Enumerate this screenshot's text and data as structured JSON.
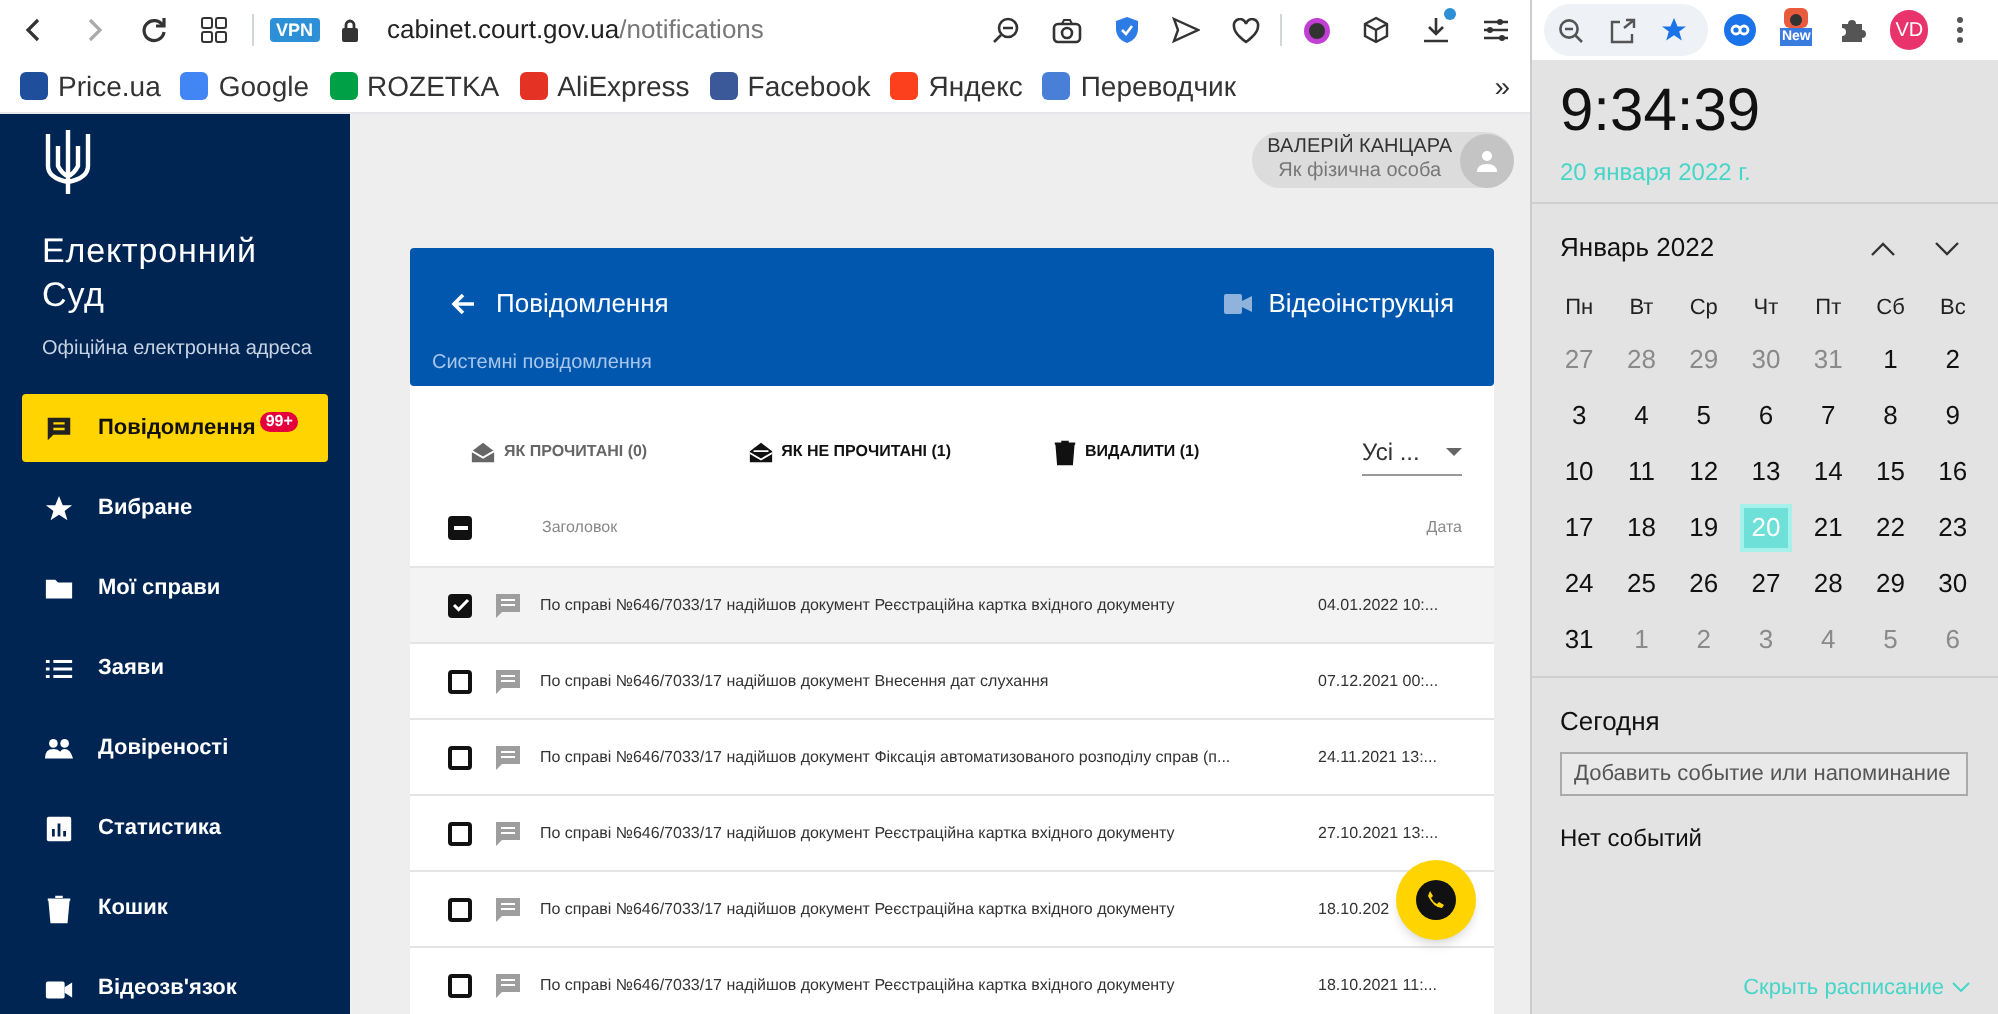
{
  "browser": {
    "vpn_badge": "VPN",
    "url_host": "cabinet.court.gov.ua",
    "url_path": "/notifications",
    "profile": "VD",
    "new_badge": "New",
    "bookmarks": [
      {
        "label": "Price.ua",
        "color": "#1f4e9c"
      },
      {
        "label": "Google",
        "color": "#4285f4"
      },
      {
        "label": "ROZETKA",
        "color": "#00a046"
      },
      {
        "label": "AliExpress",
        "color": "#e43225"
      },
      {
        "label": "Facebook",
        "color": "#3b5998"
      },
      {
        "label": "Яндекс",
        "color": "#fc3f1d"
      },
      {
        "label": "Переводчик",
        "color": "#4a7fd8"
      }
    ],
    "more": "»"
  },
  "sidebar": {
    "title": "Електронний Суд",
    "subtitle": "Офіційна електронна адреса",
    "items": [
      {
        "label": "Повідомлення",
        "selected": true,
        "badge": "99+"
      },
      {
        "label": "Вибране",
        "selected": false
      },
      {
        "label": "Мої справи",
        "selected": false
      },
      {
        "label": "Заяви",
        "selected": false
      },
      {
        "label": "Довіреності",
        "selected": false
      },
      {
        "label": "Статистика",
        "selected": false
      },
      {
        "label": "Кошик",
        "selected": false
      },
      {
        "label": "Відеозв'язок",
        "selected": false
      }
    ]
  },
  "user": {
    "name": "ВАЛЕРІЙ КАНЦАРА",
    "role": "Як фізична особа"
  },
  "panel": {
    "title": "Повідомлення",
    "subtitle": "Системні повідомлення",
    "video_link": "Відеоінструкція",
    "actions": [
      {
        "label": "ЯК ПРОЧИТАНІ (0)",
        "disabled": true
      },
      {
        "label": "ЯК НЕ ПРОЧИТАНІ (1)",
        "disabled": false
      },
      {
        "label": "ВИДАЛИТИ (1)",
        "disabled": false
      }
    ],
    "filter": "Усі ...",
    "header_checkbox": {
      "indeterminate": true
    },
    "columns": [
      "Заголовок",
      "Дата"
    ],
    "rows": [
      {
        "title": "По справі №646/7033/17 надійшов документ Реєстраційна картка вхідного документу",
        "date": "04.01.2022 10:...",
        "checked": true
      },
      {
        "title": "По справі №646/7033/17 надійшов документ Внесення дат слухання",
        "date": "07.12.2021 00:...",
        "checked": false
      },
      {
        "title": "По справі №646/7033/17 надійшов документ Фіксація автоматизованого розподілу справ (п...",
        "date": "24.11.2021 13:...",
        "checked": false
      },
      {
        "title": "По справі №646/7033/17 надійшов документ Реєстраційна картка вхідного документу",
        "date": "27.10.2021 13:...",
        "checked": false
      },
      {
        "title": "По справі №646/7033/17 надійшов документ Реєстраційна картка вхідного документу",
        "date": "18.10.202",
        "checked": false
      },
      {
        "title": "По справі №646/7033/17 надійшов документ Реєстраційна картка вхідного документу",
        "date": "18.10.2021 11:...",
        "checked": false
      }
    ]
  },
  "clock": {
    "time": "9:34:39",
    "date": "20 января 2022 г.",
    "month": "Январь 2022",
    "weekdays": [
      "Пн",
      "Вт",
      "Ср",
      "Чт",
      "Пт",
      "Сб",
      "Вс"
    ],
    "weeks": [
      [
        {
          "day": "27",
          "muted": true,
          "selected": false
        },
        {
          "day": "28",
          "muted": true,
          "selected": false
        },
        {
          "day": "29",
          "muted": true,
          "selected": false
        },
        {
          "day": "30",
          "muted": true,
          "selected": false
        },
        {
          "day": "31",
          "muted": true,
          "selected": false
        },
        {
          "day": "1",
          "muted": false,
          "selected": false
        },
        {
          "day": "2",
          "muted": false,
          "selected": false
        }
      ],
      [
        {
          "day": "3",
          "muted": false,
          "selected": false
        },
        {
          "day": "4",
          "muted": false,
          "selected": false
        },
        {
          "day": "5",
          "muted": false,
          "selected": false
        },
        {
          "day": "6",
          "muted": false,
          "selected": false
        },
        {
          "day": "7",
          "muted": false,
          "selected": false
        },
        {
          "day": "8",
          "muted": false,
          "selected": false
        },
        {
          "day": "9",
          "muted": false,
          "selected": false
        }
      ],
      [
        {
          "day": "10",
          "muted": false,
          "selected": false
        },
        {
          "day": "11",
          "muted": false,
          "selected": false
        },
        {
          "day": "12",
          "muted": false,
          "selected": false
        },
        {
          "day": "13",
          "muted": false,
          "selected": false
        },
        {
          "day": "14",
          "muted": false,
          "selected": false
        },
        {
          "day": "15",
          "muted": false,
          "selected": false
        },
        {
          "day": "16",
          "muted": false,
          "selected": false
        }
      ],
      [
        {
          "day": "17",
          "muted": false,
          "selected": false
        },
        {
          "day": "18",
          "muted": false,
          "selected": false
        },
        {
          "day": "19",
          "muted": false,
          "selected": false
        },
        {
          "day": "20",
          "muted": false,
          "selected": true
        },
        {
          "day": "21",
          "muted": false,
          "selected": false
        },
        {
          "day": "22",
          "muted": false,
          "selected": false
        },
        {
          "day": "23",
          "muted": false,
          "selected": false
        }
      ],
      [
        {
          "day": "24",
          "muted": false,
          "selected": false
        },
        {
          "day": "25",
          "muted": false,
          "selected": false
        },
        {
          "day": "26",
          "muted": false,
          "selected": false
        },
        {
          "day": "27",
          "muted": false,
          "selected": false
        },
        {
          "day": "28",
          "muted": false,
          "selected": false
        },
        {
          "day": "29",
          "muted": false,
          "selected": false
        },
        {
          "day": "30",
          "muted": false,
          "selected": false
        }
      ],
      [
        {
          "day": "31",
          "muted": false,
          "selected": false
        },
        {
          "day": "1",
          "muted": true,
          "selected": false
        },
        {
          "day": "2",
          "muted": true,
          "selected": false
        },
        {
          "day": "3",
          "muted": true,
          "selected": false
        },
        {
          "day": "4",
          "muted": true,
          "selected": false
        },
        {
          "day": "5",
          "muted": true,
          "selected": false
        },
        {
          "day": "6",
          "muted": true,
          "selected": false
        }
      ]
    ],
    "today_label": "Сегодня",
    "event_placeholder": "Добавить событие или напоминание",
    "no_events": "Нет событий",
    "hide_link": "Скрыть расписание"
  }
}
